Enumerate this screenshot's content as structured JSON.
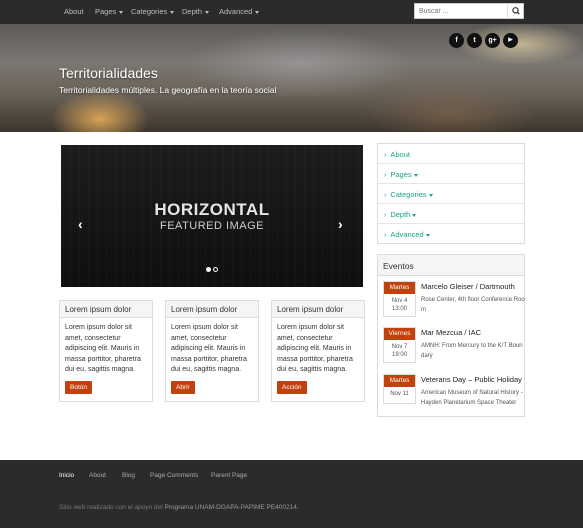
{
  "topnav": {
    "items": [
      {
        "label": "About",
        "has_caret": false
      },
      {
        "label": "Pages",
        "has_caret": true
      },
      {
        "label": "Categories",
        "has_caret": true
      },
      {
        "label": "Depth",
        "has_caret": true
      },
      {
        "label": "Advanced",
        "has_caret": true
      }
    ],
    "search_placeholder": "Buscar ..."
  },
  "header": {
    "title": "Territorialidades",
    "subtitle": "Territorialidades múltiples. La geografía en la teoría social",
    "social": [
      {
        "icon": "facebook-icon",
        "glyph": "f"
      },
      {
        "icon": "twitter-icon",
        "glyph": "t"
      },
      {
        "icon": "google-plus-icon",
        "glyph": "g+"
      },
      {
        "icon": "youtube-icon",
        "glyph": "▶"
      }
    ]
  },
  "slider": {
    "title": "HORIZONTAL",
    "subtitle": "FEATURED IMAGE",
    "prev": "‹",
    "next": "›",
    "slide_count": 2,
    "active_index": 0
  },
  "cards": [
    {
      "title": "Lorem ipsum dolor",
      "body": "Lorem ipsum dolor sit amet, consectetur adipiscing elit. Mauris in massa porttitor, pharetra dui eu, sagittis magna.",
      "button": "Botón"
    },
    {
      "title": "Lorem ipsum dolor",
      "body": "Lorem ipsum dolor sit amet, consectetur adipiscing elit. Mauris in massa porttitor, pharetra dui eu, sagittis magna.",
      "button": "Abrir"
    },
    {
      "title": "Lorem ipsum dolor",
      "body": "Lorem ipsum dolor sit amet, consectetur adipiscing elit. Mauris in massa porttitor, pharetra dui eu, sagittis magna.",
      "button": "Acción"
    }
  ],
  "sidebar_menu": [
    {
      "label": "About",
      "has_caret": false
    },
    {
      "label": "Pages",
      "has_caret": true
    },
    {
      "label": "Categories",
      "has_caret": true
    },
    {
      "label": "Depth",
      "has_caret": true
    },
    {
      "label": "Advanced",
      "has_caret": true
    }
  ],
  "events": {
    "heading": "Eventos",
    "items": [
      {
        "day": "Martes",
        "date": "Nov 4",
        "time": "13:00",
        "title": "Marcelo Gleiser / Dartmouth",
        "desc": "Rose Center, 4th floor Conference Room"
      },
      {
        "day": "Viernes",
        "date": "Nov 7",
        "time": "19:00",
        "title": "Mar Mezcua / IAC",
        "desc": "AMNH: From Mercury to the K/T Boundary"
      },
      {
        "day": "Martes",
        "date": "Nov 11",
        "time": "",
        "title": "Veterans Day – Public Holiday",
        "desc": "American Museum of Natural History - Hayden Planetarium Space Theater"
      }
    ]
  },
  "footer": {
    "links": [
      "Inicio",
      "About",
      "Blog",
      "Page Comments",
      "Parent Page"
    ],
    "credits_prefix": "Sitio web realizado con el apoyo del",
    "credits_program": "Programa UNAM-DGAPA-PAPIME PE400214."
  },
  "colors": {
    "accent": "#c2410c",
    "link": "#17a589",
    "nav_bg": "#2b2b2b"
  }
}
